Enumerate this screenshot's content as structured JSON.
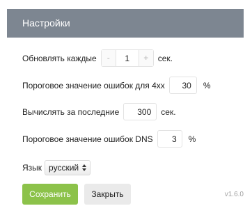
{
  "header": {
    "title": "Настройки",
    "background_color": "#7d8691"
  },
  "settings": {
    "refresh": {
      "label": "Обновлять каждые",
      "minus": "-",
      "value": "1",
      "plus": "+",
      "suffix": "сек."
    },
    "threshold_4xx": {
      "label": "Пороговое значение ошибок для 4xx",
      "value": "30",
      "suffix": "%"
    },
    "calc_period": {
      "label": "Вычислять за последние",
      "value": "300",
      "suffix": "сек."
    },
    "threshold_dns": {
      "label": "Пороговое значение ошибок DNS",
      "value": "3",
      "suffix": "%"
    },
    "language": {
      "label": "Язык",
      "selected": "русский"
    }
  },
  "buttons": {
    "save_label": "Сохранить",
    "save_color": "#8cc24a",
    "close_label": "Закрыть"
  },
  "version": "v1.6.0"
}
